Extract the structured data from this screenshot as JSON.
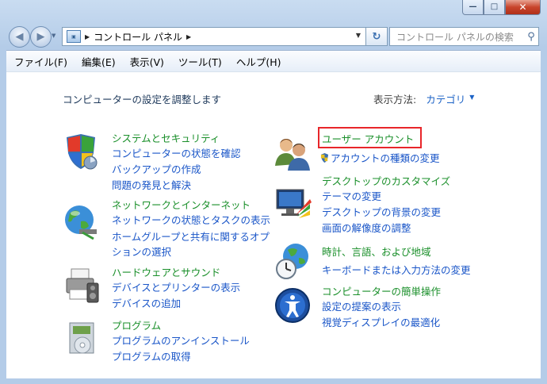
{
  "window": {
    "min_label": "—",
    "max_label": "□",
    "close_label": "✕"
  },
  "address": {
    "path": "コントロール パネル",
    "search_placeholder": "コントロール パネルの検索"
  },
  "menu": [
    "ファイル(F)",
    "編集(E)",
    "表示(V)",
    "ツール(T)",
    "ヘルプ(H)"
  ],
  "header": {
    "title": "コンピューターの設定を調整します",
    "view_by_label": "表示方法:",
    "view_by_value": "カテゴリ"
  },
  "categories": {
    "system": {
      "title": "システムとセキュリティ",
      "links": [
        "コンピューターの状態を確認",
        "バックアップの作成",
        "問題の発見と解決"
      ]
    },
    "network": {
      "title": "ネットワークとインターネット",
      "links": [
        "ネットワークの状態とタスクの表示",
        "ホームグループと共有に関するオプ",
        "ションの選択"
      ]
    },
    "hardware": {
      "title": "ハードウェアとサウンド",
      "links": [
        "デバイスとプリンターの表示",
        "デバイスの追加"
      ]
    },
    "programs": {
      "title": "プログラム",
      "links": [
        "プログラムのアンインストール",
        "プログラムの取得"
      ]
    },
    "users": {
      "title": "ユーザー アカウント",
      "links": [
        "アカウントの種類の変更"
      ]
    },
    "appearance": {
      "title": "デスクトップのカスタマイズ",
      "links": [
        "テーマの変更",
        "デスクトップの背景の変更",
        "画面の解像度の調整"
      ]
    },
    "clock": {
      "title": "時計、言語、および地域",
      "links": [
        "キーボードまたは入力方法の変更"
      ]
    },
    "ease": {
      "title": "コンピューターの簡単操作",
      "links": [
        "設定の提案の表示",
        "視覚ディスプレイの最適化"
      ]
    }
  },
  "colors": {
    "category_title": "#1a8f2a",
    "link": "#1a56c8",
    "highlight": "#e8262a"
  }
}
